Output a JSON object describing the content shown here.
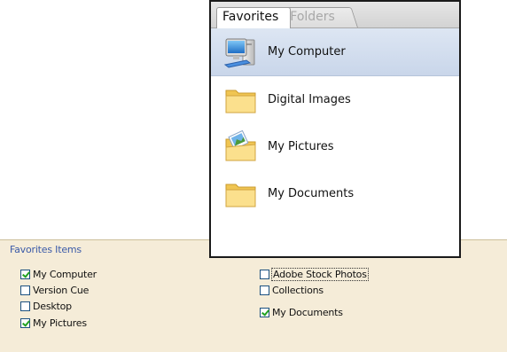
{
  "favorites_panel": {
    "tabs": [
      {
        "label": "Favorites",
        "active": true
      },
      {
        "label": "Folders",
        "active": false
      }
    ],
    "items": [
      {
        "label": "My Computer",
        "icon": "computer-icon",
        "selected": true
      },
      {
        "label": "Digital Images",
        "icon": "folder-icon",
        "selected": false
      },
      {
        "label": "My Pictures",
        "icon": "pictures-folder-icon",
        "selected": false
      },
      {
        "label": "My Documents",
        "icon": "folder-icon",
        "selected": false
      }
    ]
  },
  "preferences": {
    "section_title": "Favorites Items",
    "left_column": [
      {
        "label": "My Computer",
        "checked": true
      },
      {
        "label": "Version Cue",
        "checked": false
      },
      {
        "label": "Desktop",
        "checked": false
      },
      {
        "label": "My Pictures",
        "checked": true
      }
    ],
    "right_column": [
      {
        "label": "Adobe Stock Photos",
        "checked": false,
        "focused": true
      },
      {
        "label": "Collections",
        "checked": false
      },
      {
        "label": "My Documents",
        "checked": true
      }
    ]
  },
  "colors": {
    "panel_bg": "#f5ecd8",
    "section_title": "#3a5aa8",
    "selection": "#c9d6ea",
    "checkmark": "#21a121",
    "checkbox_border": "#1c5180"
  }
}
